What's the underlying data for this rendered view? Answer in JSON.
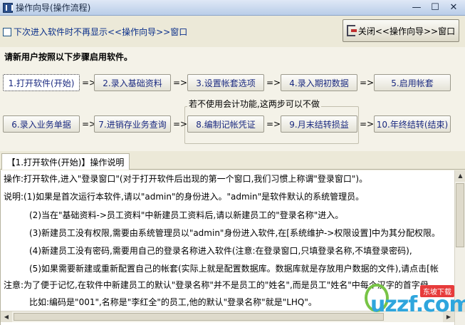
{
  "window": {
    "title": "操作向导(操作流程)",
    "controls": {
      "minimize": "—",
      "maximize": "☐",
      "close": "✕"
    }
  },
  "topbar": {
    "dont_show_label": "下次进入软件时不再显示<<操作向导>>窗口",
    "close_button_label": "关闭<<操作向导>>窗口"
  },
  "panel": {
    "intro": "请新用户按照以下步骤启用软件。",
    "arrow": "=>",
    "optional_note": "若不使用会计功能,这两步可以不做",
    "steps": [
      "1.打开软件(开始)",
      "2.录入基础资料",
      "3.设置帐套选项",
      "4.录入期初数据",
      "5.启用帐套",
      "6.录入业务单据",
      "7.进销存业务查询",
      "8.编制记帐凭证",
      "9.月末结转损益",
      "10.年终结转(结束)"
    ]
  },
  "tab": {
    "label": "【1.打开软件(开始)】操作说明"
  },
  "content": {
    "lines": [
      "操作:打开软件,进入\"登录窗口\"(对于打开软件后出现的第一个窗口,我们习惯上称谓\"登录窗口\")。",
      "说明:(1)如果是首次运行本软件,请以\"admin\"的身份进入。\"admin\"是软件默认的系统管理员。",
      "(2)当在\"基础资料->员工资料\"中新建员工资料后,请以新建员工的\"登录名称\"进入。",
      "(3)新建员工没有权限,需要由系统管理员以\"admin\"身份进入软件,在[系统维护->权限设置]中为其分配权限。",
      "(4)新建员工没有密码,需要用自己的登录名称进入软件(注意:在登录窗口,只填登录名称,不填登录密码),",
      "(5)如果需要新建或重新配置自己的帐套(实际上就是配置数据库。数据库就是存放用户数据的文件),请点击[帐",
      "注意:为了便于记忆,在软件中新建员工的默认\"登录名称\"并不是员工的\"姓名\",而是员工\"姓名\"中每个汉字的首字母",
      "比如:编码是\"001\",名称是\"李红全\"的员工,他的默认\"登录名称\"就是\"LHQ\"。"
    ]
  },
  "watermark": {
    "badge": "东坡下载",
    "logo": "uzzf.com"
  }
}
